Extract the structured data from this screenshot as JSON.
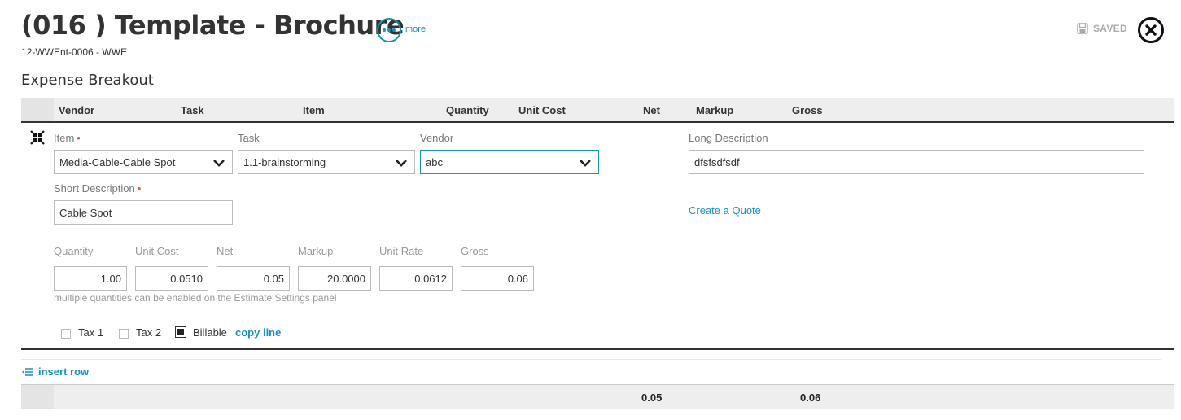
{
  "header": {
    "title": "(016 ) Template - Brochure",
    "subtitle": "12-WWEnt-0006 - WWE",
    "more_label": "more",
    "saved_label": "SAVED"
  },
  "section": {
    "title": "Expense Breakout"
  },
  "table": {
    "columns": [
      "Vendor",
      "Task",
      "Item",
      "Quantity",
      "Unit Cost",
      "Net",
      "Markup",
      "Gross"
    ]
  },
  "line": {
    "item": {
      "label": "Item",
      "value": "Media-Cable-Cable Spot"
    },
    "task": {
      "label": "Task",
      "value": "1.1-brainstorming"
    },
    "vendor": {
      "label": "Vendor",
      "value": "abc"
    },
    "long_description": {
      "label": "Long Description",
      "value": "dfsfsdfsdf"
    },
    "short_description": {
      "label": "Short Description",
      "value": "Cable Spot"
    },
    "create_quote": "Create a Quote",
    "numbers": {
      "quantity": {
        "label": "Quantity",
        "value": "1.00"
      },
      "unit_cost": {
        "label": "Unit Cost",
        "value": "0.0510"
      },
      "net": {
        "label": "Net",
        "value": "0.05"
      },
      "markup": {
        "label": "Markup",
        "value": "20.0000"
      },
      "unit_rate": {
        "label": "Unit Rate",
        "value": "0.0612"
      },
      "gross": {
        "label": "Gross",
        "value": "0.06"
      }
    },
    "hint": "multiple quantities can be enabled on the Estimate Settings panel",
    "checks": {
      "tax1": {
        "label": "Tax 1",
        "checked": false
      },
      "tax2": {
        "label": "Tax 2",
        "checked": false
      },
      "billable": {
        "label": "Billable",
        "checked": true
      }
    },
    "copy_line": "copy line"
  },
  "insert_row": "insert row",
  "totals": {
    "net": "0.05",
    "gross": "0.06"
  },
  "colors": {
    "accent": "#1a8fc0",
    "required": "#d9534f",
    "header_bg": "#eeeeee"
  }
}
